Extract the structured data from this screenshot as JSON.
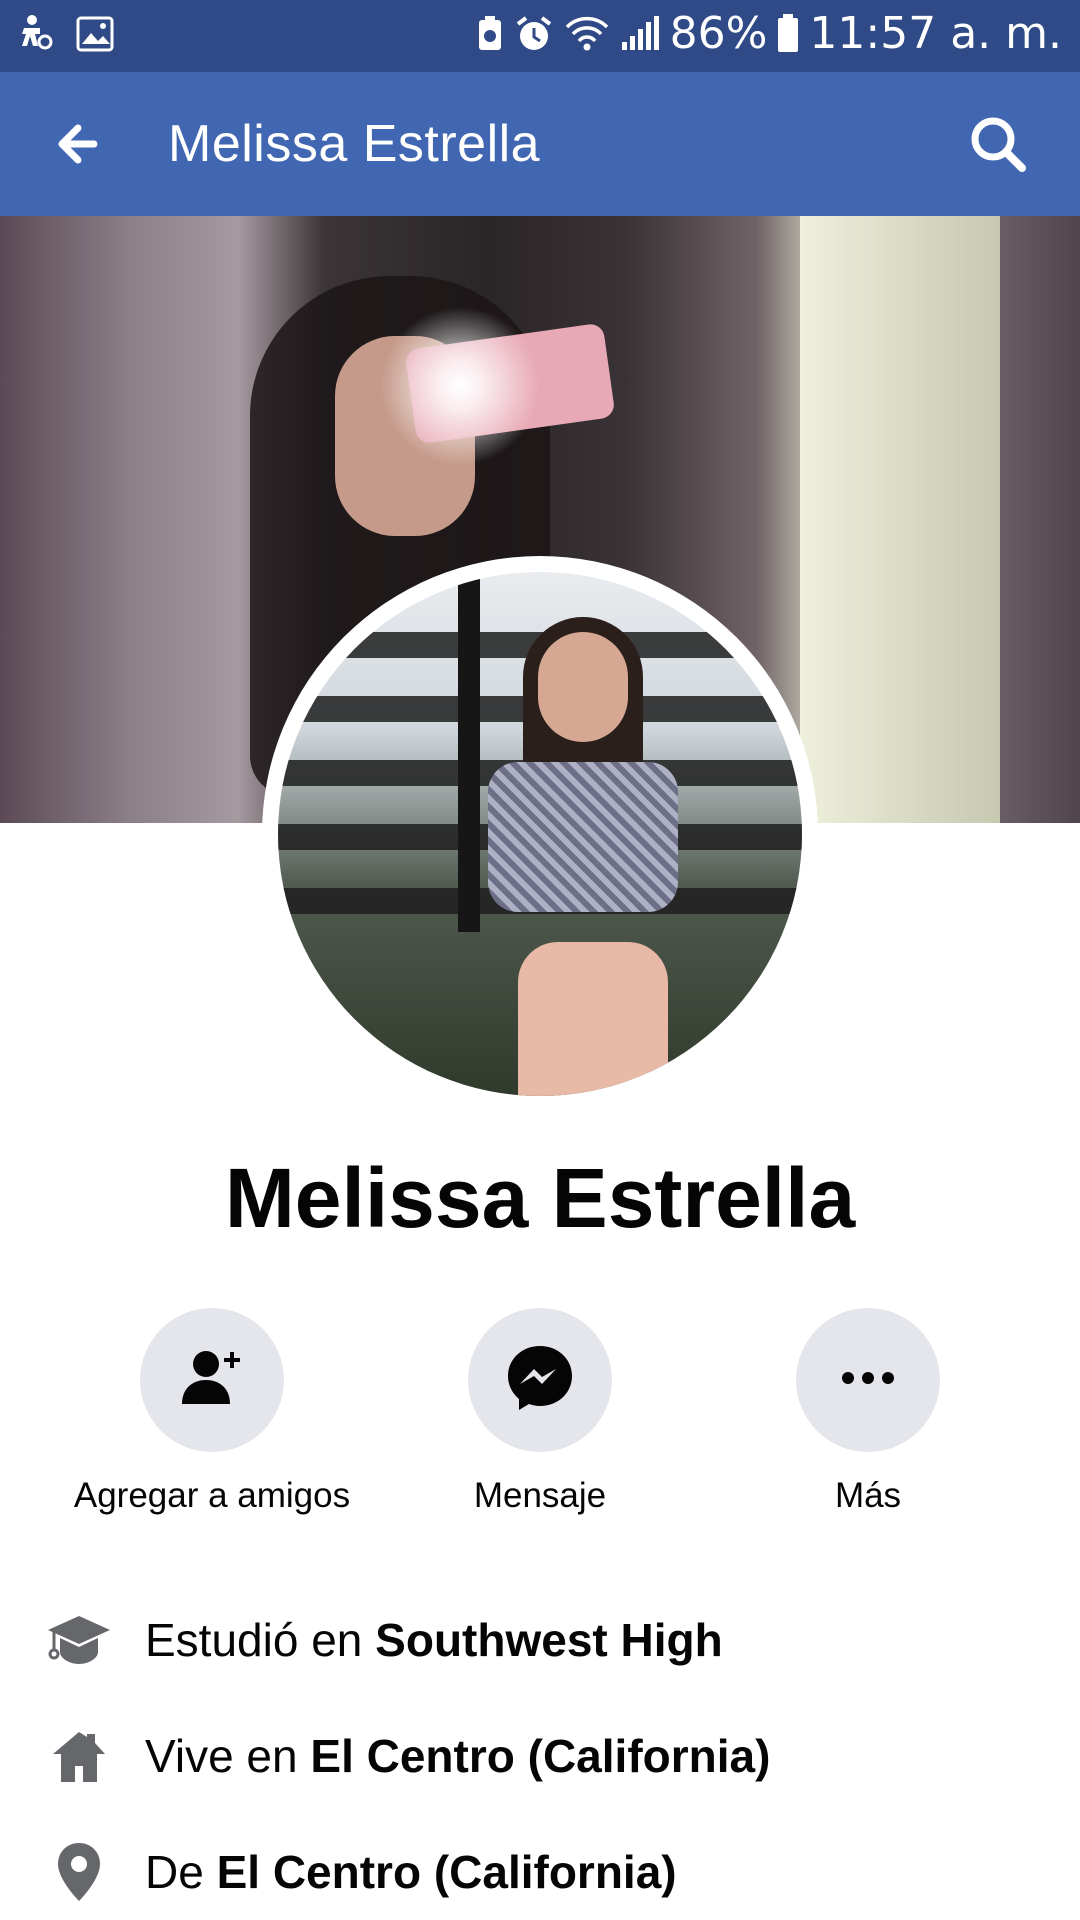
{
  "status_bar": {
    "battery": "86%",
    "time": "11:57 a. m."
  },
  "app_bar": {
    "title": "Melissa Estrella"
  },
  "profile": {
    "name": "Melissa Estrella"
  },
  "actions": [
    {
      "label": "Agregar a amigos",
      "icon": "add-friend-icon"
    },
    {
      "label": "Mensaje",
      "icon": "messenger-icon"
    },
    {
      "label": "Más",
      "icon": "more-icon"
    }
  ],
  "details": [
    {
      "prefix": "Estudió en ",
      "value": "Southwest High",
      "icon": "graduation-cap-icon"
    },
    {
      "prefix": "Vive en ",
      "value": "El Centro (California)",
      "icon": "home-icon"
    },
    {
      "prefix": "De ",
      "value": "El Centro (California)",
      "icon": "location-pin-icon"
    }
  ],
  "colors": {
    "status_bar": "#2f4a86",
    "app_bar": "#4267b2",
    "action_circle": "#e4e6eb",
    "icon_gray": "#65676b"
  }
}
